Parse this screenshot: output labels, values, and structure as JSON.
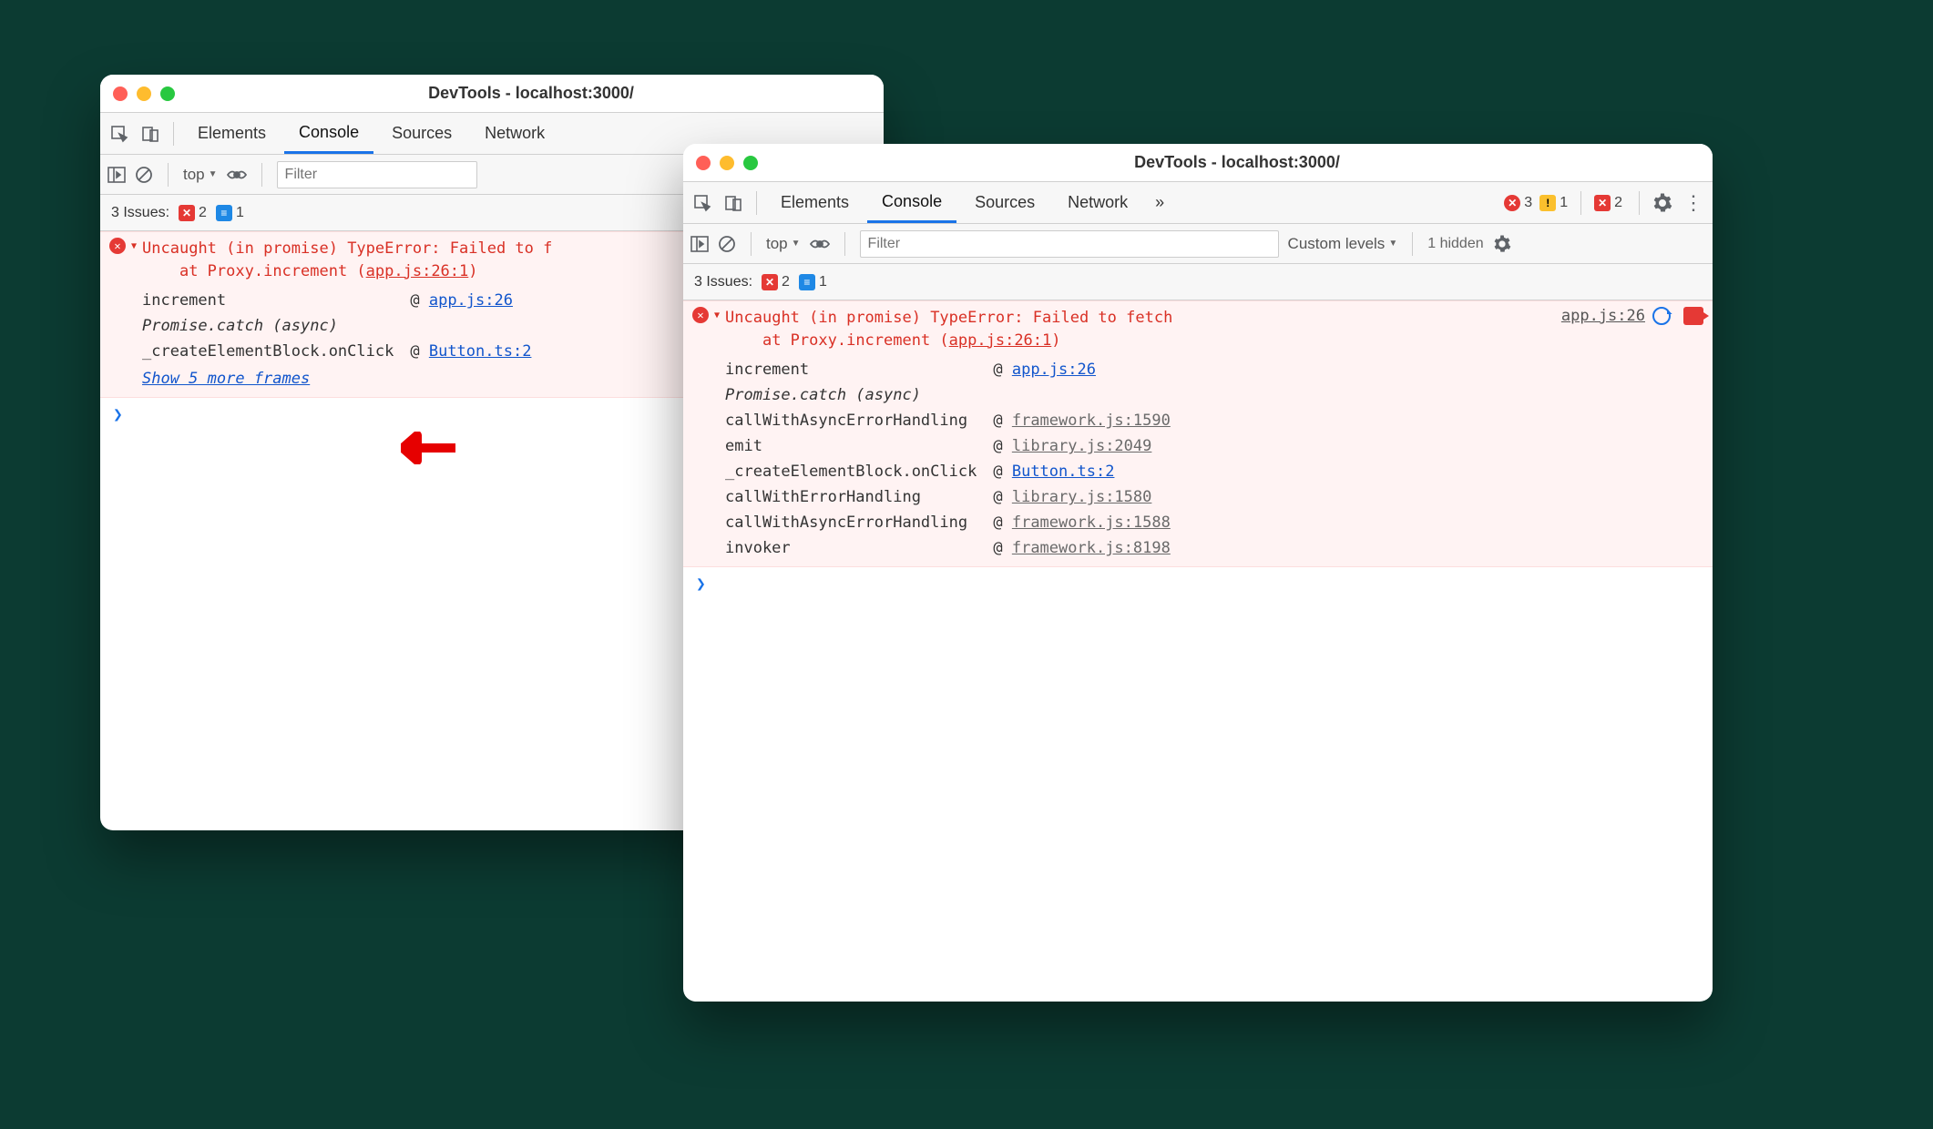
{
  "win1": {
    "title": "DevTools - localhost:3000/",
    "tabs": [
      "Elements",
      "Console",
      "Sources",
      "Network"
    ],
    "active_tab": "Console",
    "context": "top",
    "filter_placeholder": "Filter",
    "issues_label": "3 Issues:",
    "issues_err": "2",
    "issues_msg": "1",
    "err": {
      "text": "Uncaught (in promise) TypeError: Failed to f\n    at Proxy.increment (",
      "anchor": "app.js:26:1",
      "close": ")"
    },
    "stack": [
      {
        "fn": "increment",
        "at": "@",
        "loc": "app.js:26",
        "muted": false
      },
      {
        "fn": "Promise.catch (async)",
        "async": true
      },
      {
        "fn": "_createElementBlock.onClick",
        "at": "@",
        "loc": "Button.ts:2",
        "muted": false
      }
    ],
    "show_more": "Show 5 more frames"
  },
  "win2": {
    "title": "DevTools - localhost:3000/",
    "tabs": [
      "Elements",
      "Console",
      "Sources",
      "Network"
    ],
    "active_tab": "Console",
    "overflow": "»",
    "counters": {
      "err": "3",
      "warn": "1",
      "issue_err": "2"
    },
    "gear": "⚙",
    "more": "⋮",
    "context": "top",
    "filter_placeholder": "Filter",
    "levels": "Custom levels",
    "hidden": "1 hidden",
    "issues_label": "3 Issues:",
    "issues_err": "2",
    "issues_msg": "1",
    "err": {
      "text": "Uncaught (in promise) TypeError: Failed to fetch\n    at Proxy.increment (",
      "anchor": "app.js:26:1",
      "close": ")",
      "loc": "app.js:26"
    },
    "stack": [
      {
        "fn": "increment",
        "at": "@",
        "loc": "app.js:26",
        "muted": false
      },
      {
        "fn": "Promise.catch (async)",
        "async": true
      },
      {
        "fn": "callWithAsyncErrorHandling",
        "at": "@",
        "loc": "framework.js:1590",
        "muted": true
      },
      {
        "fn": "emit",
        "at": "@",
        "loc": "library.js:2049",
        "muted": true
      },
      {
        "fn": "_createElementBlock.onClick",
        "at": "@",
        "loc": "Button.ts:2",
        "muted": false
      },
      {
        "fn": "callWithErrorHandling",
        "at": "@",
        "loc": "library.js:1580",
        "muted": true
      },
      {
        "fn": "callWithAsyncErrorHandling",
        "at": "@",
        "loc": "framework.js:1588",
        "muted": true
      },
      {
        "fn": "invoker",
        "at": "@",
        "loc": "framework.js:8198",
        "muted": true
      }
    ]
  },
  "prompt": "❯"
}
